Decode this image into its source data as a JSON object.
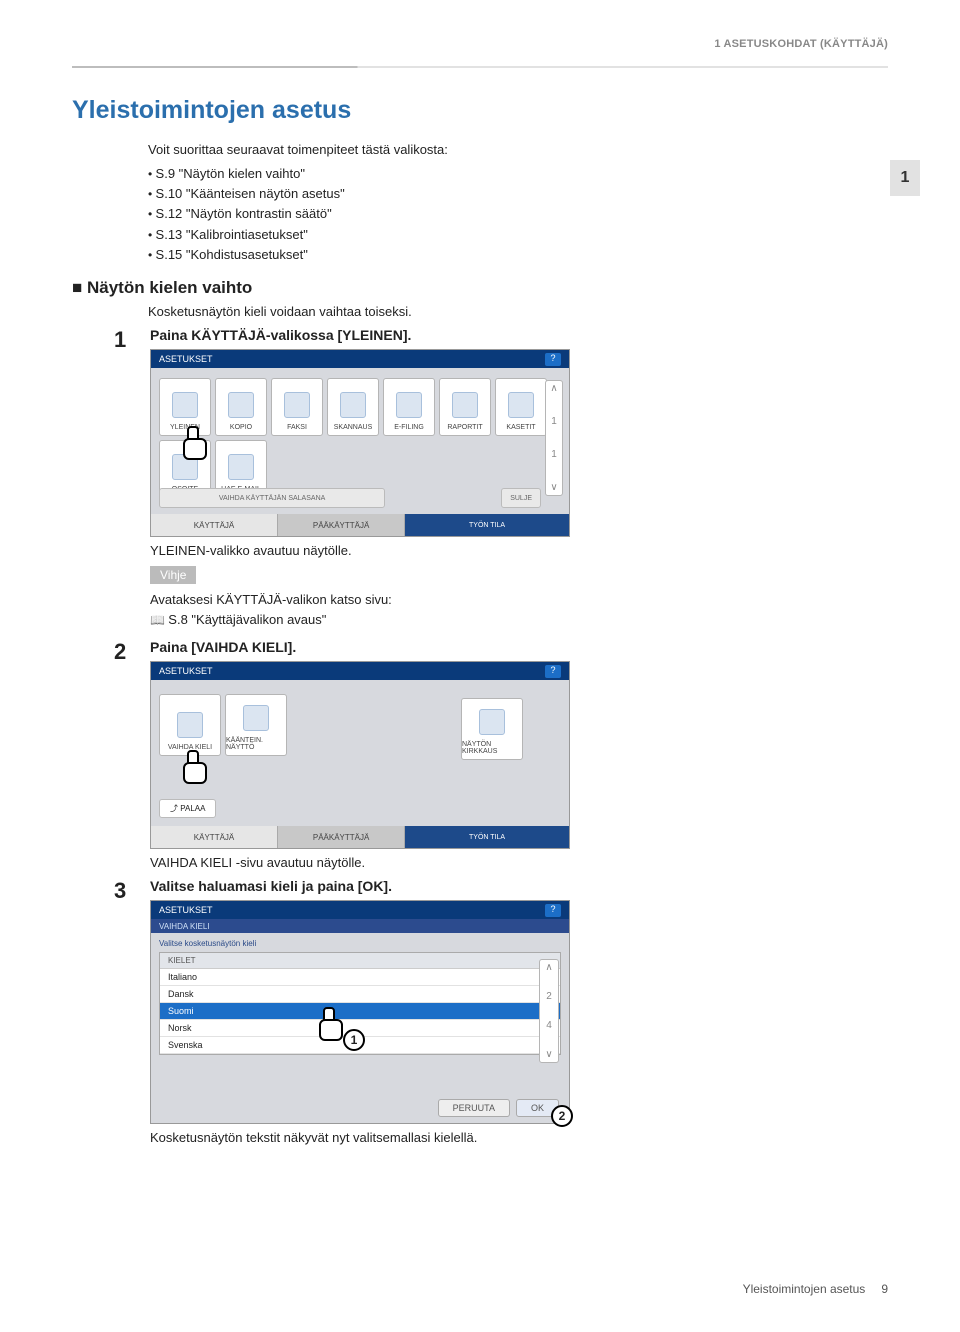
{
  "header": {
    "chapter": "1 ASETUSKOHDAT (KÄYTTÄJÄ)"
  },
  "page_tab": "1",
  "title": "Yleistoimintojen asetus",
  "intro": {
    "lead": "Voit suorittaa seuraavat toimenpiteet tästä valikosta:",
    "items": [
      "S.9 \"Näytön kielen vaihto\"",
      "S.10 \"Käänteisen näytön asetus\"",
      "S.12 \"Näytön kontrastin säätö\"",
      "S.13 \"Kalibrointiasetukset\"",
      "S.15 \"Kohdistusasetukset\""
    ]
  },
  "section": {
    "heading": "Näytön kielen vaihto",
    "sub": "Kosketusnäytön kieli voidaan vaihtaa toiseksi."
  },
  "steps": {
    "s1": {
      "num": "1",
      "title": "Paina KÄYTTÄJÄ-valikossa [YLEINEN].",
      "after": "YLEINEN-valikko avautuu näytölle."
    },
    "s2": {
      "num": "2",
      "title": "Paina [VAIHDA KIELI].",
      "after": "VAIHDA KIELI -sivu avautuu näytölle."
    },
    "s3": {
      "num": "3",
      "title": "Valitse haluamasi kieli ja paina [OK].",
      "after": "Kosketusnäytön tekstit näkyvät nyt valitsemallasi kielellä."
    }
  },
  "tip": {
    "label": "Vihje",
    "line1": "Avataksesi KÄYTTÄJÄ-valikon katso sivu:",
    "line2": "S.8 \"Käyttäjävalikon avaus\""
  },
  "shot1": {
    "title": "ASETUKSET",
    "help": "?",
    "buttons": [
      "YLEINEN",
      "KOPIO",
      "FAKSI",
      "SKANNAUS",
      "E-FILING",
      "RAPORTIT",
      "KASETIT",
      "OSOITE",
      "HAE E-MAIL"
    ],
    "scroll_page": "1",
    "scroll_total": "1",
    "toolbar_left": "VAIHDA KÄYTTÄJÄN SALASANA",
    "toolbar_right": "SULJE",
    "tab1": "KÄYTTÄJÄ",
    "tab2": "PÄÄKÄYTTÄJÄ",
    "status": "TYÖN TILA"
  },
  "shot2": {
    "title": "ASETUKSET",
    "help": "?",
    "btn_left1": "VAIHDA KIELI",
    "btn_left2": "KÄÄNTEIN. NÄYTTÖ",
    "btn_right": "NÄYTÖN KIRKKAUS",
    "back": "PALAA",
    "tab1": "KÄYTTÄJÄ",
    "tab2": "PÄÄKÄYTTÄJÄ",
    "status": "TYÖN TILA"
  },
  "shot3": {
    "title": "ASETUKSET",
    "subtitle": "VAIHDA KIELI",
    "help": "?",
    "hint": "Valitse kosketusnäytön kieli",
    "list_header": "KIELET",
    "items": [
      "Italiano",
      "Dansk",
      "Suomi",
      "Norsk",
      "Svenska"
    ],
    "selected_index": 2,
    "page": "2",
    "total": "4",
    "cancel": "PERUUTA",
    "ok": "OK"
  },
  "footer": {
    "section": "Yleistoimintojen asetus",
    "page": "9"
  }
}
